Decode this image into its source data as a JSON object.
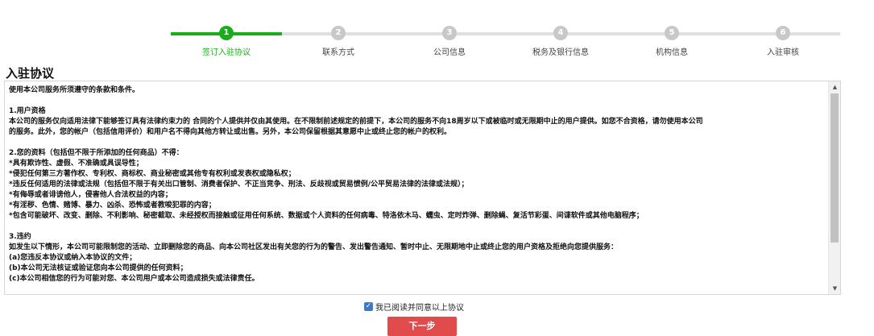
{
  "stepper": {
    "steps": [
      {
        "number": "1",
        "label": "签订入驻协议",
        "state": "active"
      },
      {
        "number": "2",
        "label": "联系方式",
        "state": "pending"
      },
      {
        "number": "3",
        "label": "公司信息",
        "state": "pending"
      },
      {
        "number": "4",
        "label": "税务及银行信息",
        "state": "pending"
      },
      {
        "number": "5",
        "label": "机构信息",
        "state": "pending"
      },
      {
        "number": "6",
        "label": "入驻审核",
        "state": "pending"
      }
    ],
    "active_color": "#1aad19",
    "pending_color": "#c8c8c8"
  },
  "page_title": "入驻协议",
  "agreement": {
    "lines": [
      "使用本公司服务所须遵守的条款和条件。",
      "",
      "1.用户资格",
      "本公司的服务仅向适用法律下能够签订具有法律约束力的 合同的个人提供并仅由其使用。在不限制前述规定的前提下，本公司的服务不向18周岁以下或被临时或无限期中止的用户提供。如您不合资格，请勿使用本公司",
      "的服务。此外，您的帐户（包括信用评价）和用户名不得向其他方转让或出售。另外，本公司保留根据其意愿中止或终止您的帐户的权利。",
      "",
      "2.您的资料（包括但不限于所添加的任何商品）不得：",
      "*具有欺诈性、虚假、不准确或具误导性；",
      "*侵犯任何第三方著作权、专利权、商标权、商业秘密或其他专有权利或发表权或隐私权；",
      "*违反任何适用的法律或法规（包括但不限于有关出口管制、消费者保护、不正当竞争、刑法、反歧视或贸易惯例/公平贸易法律的法律或法规）；",
      "*有侮辱或者诽谤他人，侵害他人合法权益的内容；",
      "*有淫秽、色情、赌博、暴力、凶杀、恐怖或者教唆犯罪的内容；",
      "*包含可能破坏、改变、删除、不利影响、秘密截取、未经授权而接触或征用任何系统、数据或个人资料的任何病毒、特洛依木马、蠕虫、定时炸弹、删除蝇、复活节彩蛋、间谍软件或其他电脑程序；",
      "",
      "3.违约",
      "如发生以下情形，本公司可能限制您的活动、立即删除您的商品、向本公司社区发出有关您的行为的警告、发出警告通知、暂时中止、无限期地中止或终止您的用户资格及拒绝向您提供服务：",
      "(a)您违反本协议或纳入本协议的文件；",
      "(b)本公司无法核证或验证您向本公司提供的任何资料；",
      "(c)本公司相信您的行为可能对您、本公司用户或本公司造成损失或法律责任。"
    ]
  },
  "agree_checkbox": {
    "label": "我已阅读并同意以上协议",
    "checked": true
  },
  "next_button": {
    "label": "下一步",
    "color": "#e24b4b"
  }
}
